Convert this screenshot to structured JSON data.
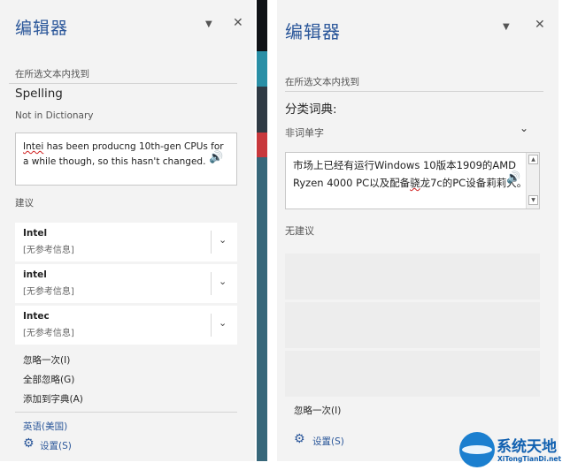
{
  "left_pane": {
    "title": "编辑器",
    "found_label": "在所选文本内找到",
    "spelling_title": "Spelling",
    "not_in_dict": "Not in Dictionary",
    "text_error_word": "Intei",
    "text_rest": " has been producng 10th-gen CPUs for a while though, so this hasn't changed.",
    "suggestions_label": "建议",
    "suggestions": [
      {
        "word": "Intel",
        "note": "[无参考信息]"
      },
      {
        "word": "intel",
        "note": "[无参考信息]"
      },
      {
        "word": "Intec",
        "note": "[无参考信息]"
      }
    ],
    "actions": {
      "ignore_once": "忽略一次(I)",
      "ignore_all": "全部忽略(G)",
      "add_to_dict": "添加到字典(A)"
    },
    "language": "英语(美国)",
    "settings": "设置(S)"
  },
  "right_pane": {
    "title": "编辑器",
    "found_label": "在所选文本内找到",
    "category_title": "分类词典:",
    "non_word_label": "非词单字",
    "text_part1": "市场上已经有运行Windows 10版本1909的AMD Ryzen 4000 PC以及配备",
    "text_error": "骁",
    "text_part2": "龙7c的PC设备莉莉大。",
    "no_suggestions": "无建议",
    "ignore_once": "忽略一次(I)",
    "settings": "设置(S)"
  },
  "icons": {
    "dropdown": "▼",
    "close": "✕",
    "speaker": "🔊",
    "chevron": "⌄",
    "gear": "⚙",
    "scroll_up": "▲",
    "scroll_down": "▼"
  },
  "watermark": {
    "name": "系统天地",
    "url": "XiTongTianDi.net"
  },
  "colors": {
    "accent": "#2b579a",
    "pane_bg": "#f3f3f3",
    "error": "#d02020"
  }
}
